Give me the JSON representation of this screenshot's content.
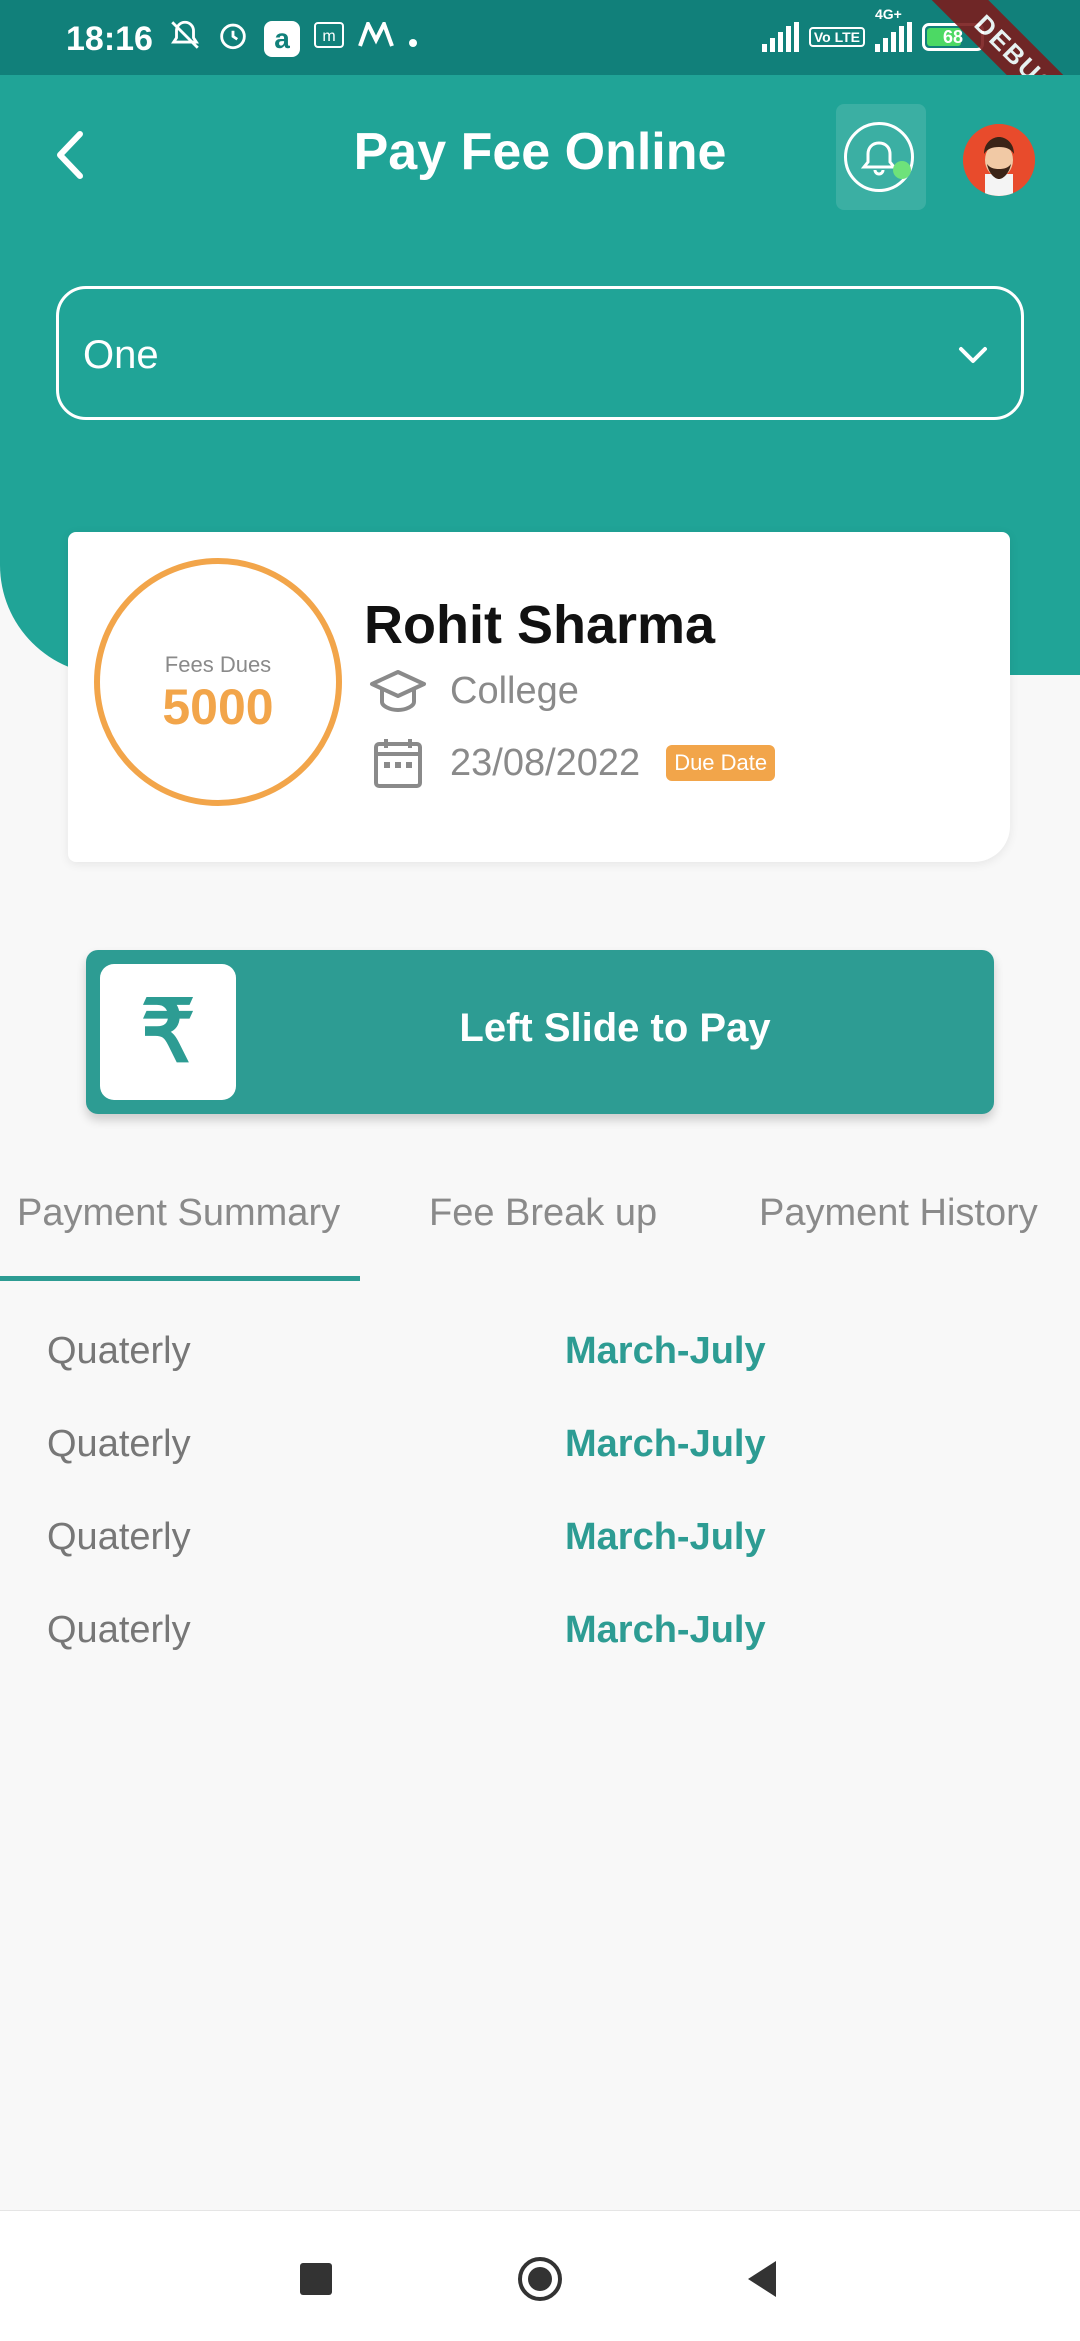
{
  "status_bar": {
    "time": "18:16",
    "battery": "68",
    "battery_level": 0.68,
    "volte_label": "Vo LTE",
    "network_label": "4G+",
    "debug_label": "DEBUG"
  },
  "header": {
    "title": "Pay Fee Online",
    "back_icon": "back-arrow-icon",
    "notification_icon": "bell-icon",
    "avatar": "user-avatar"
  },
  "class_select": {
    "value": "One"
  },
  "student_card": {
    "fees_label": "Fees Dues",
    "fees_amount": "5000",
    "name": "Rohit Sharma",
    "institution": "College",
    "due_date": "23/08/2022",
    "due_badge": "Due Date"
  },
  "slide_pay": {
    "knob_symbol": "₹",
    "label": "Left Slide to Pay"
  },
  "tabs": [
    {
      "label": "Payment Summary",
      "active": true
    },
    {
      "label": "Fee Break up",
      "active": false
    },
    {
      "label": "Payment History",
      "active": false
    }
  ],
  "summary_rows": [
    {
      "type": "Quaterly",
      "period": "March-July"
    },
    {
      "type": "Quaterly",
      "period": "March-July"
    },
    {
      "type": "Quaterly",
      "period": "March-July"
    },
    {
      "type": "Quaterly",
      "period": "March-July"
    }
  ],
  "colors": {
    "primary": "#20a497",
    "accent": "#f2a54a",
    "status_bar": "#11807a"
  }
}
